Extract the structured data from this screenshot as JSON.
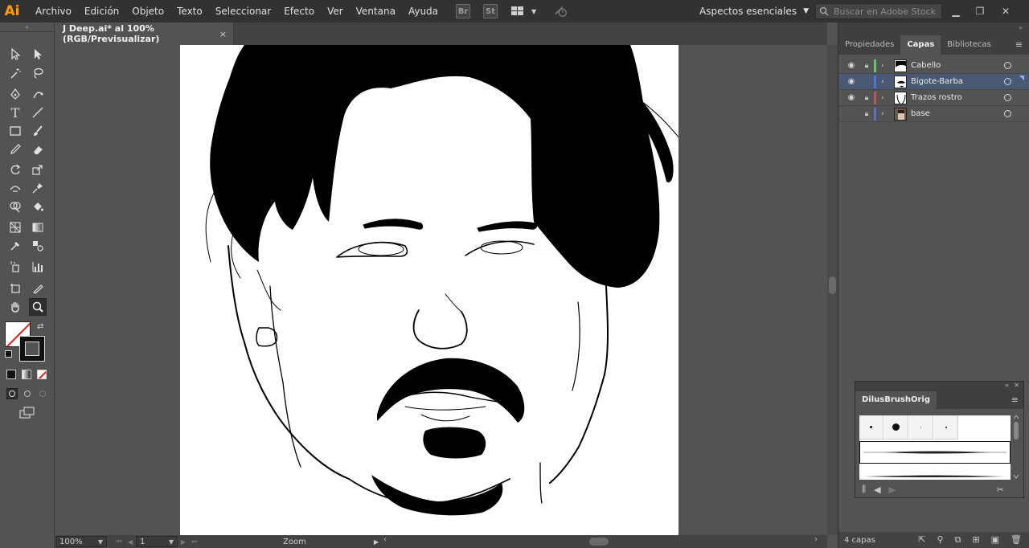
{
  "app": {
    "logo": "Ai"
  },
  "menu": [
    "Archivo",
    "Edición",
    "Objeto",
    "Texto",
    "Seleccionar",
    "Efecto",
    "Ver",
    "Ventana",
    "Ayuda"
  ],
  "menubar_icons": {
    "bridge": "Br",
    "stock": "St"
  },
  "workspace": {
    "label": "Aspectos esenciales"
  },
  "search": {
    "placeholder": "Buscar en Adobe Stock"
  },
  "document": {
    "tab_title": "J Deep.ai* al 100% (RGB/Previsualizar)",
    "close": "×"
  },
  "status": {
    "zoom": "100%",
    "page": "1",
    "tool_label": "Zoom"
  },
  "panel": {
    "tabs": [
      "Propiedades",
      "Capas",
      "Bibliotecas"
    ],
    "active_tab": "Capas",
    "layers": [
      {
        "name": "Cabello",
        "visible": true,
        "locked": true,
        "color": "#4cd94c",
        "selected": false
      },
      {
        "name": "Bigote-Barba",
        "visible": true,
        "locked": false,
        "color": "#4f6fff",
        "selected": true
      },
      {
        "name": "Trazos rostro",
        "visible": true,
        "locked": true,
        "color": "#e04646",
        "selected": false
      },
      {
        "name": "base",
        "visible": false,
        "locked": true,
        "color": "#4f6fff",
        "selected": false
      }
    ],
    "layer_count": "4 capas"
  },
  "brush_panel": {
    "title": "DilusBrushOrig"
  }
}
